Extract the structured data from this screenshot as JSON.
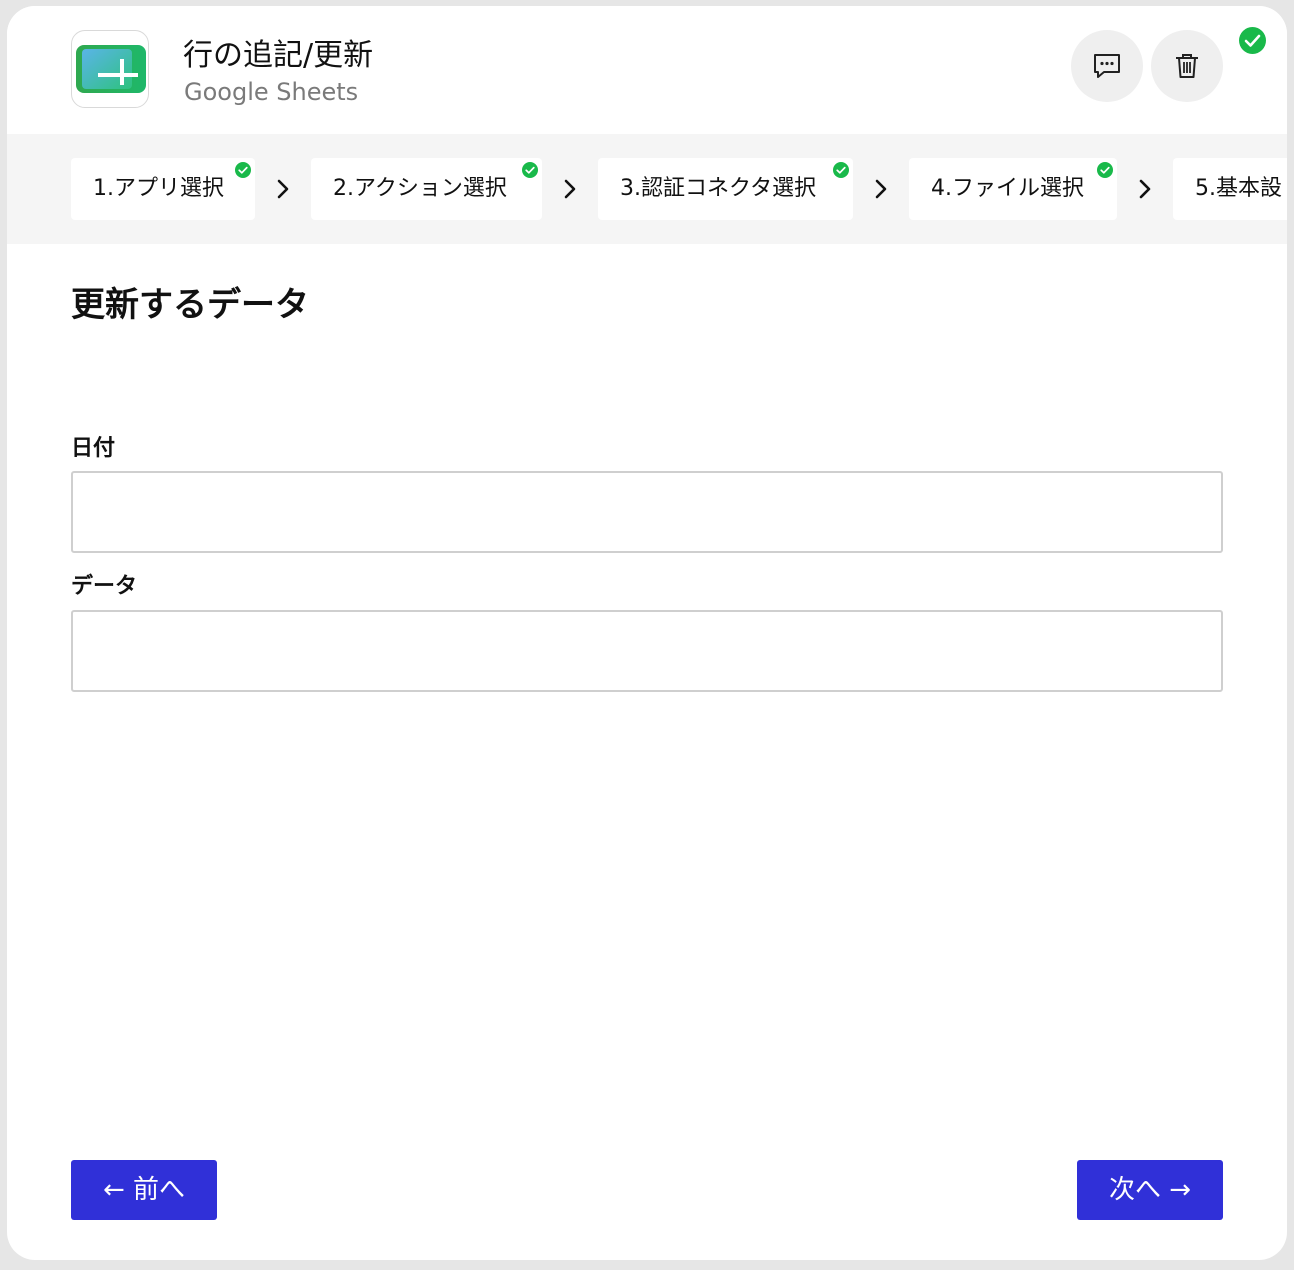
{
  "header": {
    "title": "行の追記/更新",
    "subtitle": "Google Sheets",
    "icons": [
      "google-sheets-icon",
      "comment-icon",
      "trash-icon",
      "check-circle-icon"
    ],
    "status_color": "#19b94a"
  },
  "steps": [
    {
      "label": "1.アプリ選択",
      "completed": true
    },
    {
      "label": "2.アクション選択",
      "completed": true
    },
    {
      "label": "3.認証コネクタ選択",
      "completed": true
    },
    {
      "label": "4.ファイル選択",
      "completed": true
    },
    {
      "label": "5.基本設",
      "completed": false
    }
  ],
  "main": {
    "section_title": "更新するデータ",
    "fields": [
      {
        "label": "日付",
        "value": "",
        "placeholder": ""
      },
      {
        "label": "データ",
        "value": "",
        "placeholder": ""
      }
    ]
  },
  "footer": {
    "prev_label": "← 前へ",
    "next_label": "次へ →",
    "button_color": "#3030d8"
  }
}
